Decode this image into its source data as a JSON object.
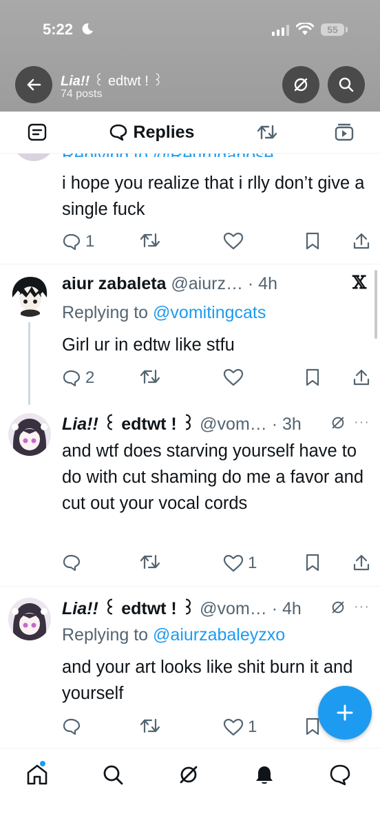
{
  "status_bar": {
    "time": "5:22",
    "battery": "55"
  },
  "header": {
    "name_part1": "Lia!!",
    "name_part2": " ꒰ edtwt ! ꒱",
    "posts_count": "74 posts"
  },
  "tabs": {
    "replies_label": "Replies"
  },
  "tweets": [
    {
      "replying_partial": "Replying to @Reuruganose",
      "text": "i hope you realize that i rlly don’t give a single fuck",
      "reply_count": "1",
      "repost_count": "",
      "like_count": ""
    },
    {
      "name": "aiur zabaleta",
      "handle_time": " @aiurz… · 4h",
      "replying_prefix": "Replying to ",
      "replying_to": "@vomitingcats",
      "text": "Girl ur in edtw like stfu",
      "reply_count": "2",
      "repost_count": "",
      "like_count": ""
    },
    {
      "name_part1": "Lia!!",
      "name_part2": " ꒰ edtwt ! ꒱",
      "handle_time": " @vom… · 3h",
      "text": "and wtf does starving yourself have to do with cut shaming do me a favor and cut out your vocal cords",
      "reply_count": "",
      "repost_count": "",
      "like_count": "1"
    },
    {
      "name_part1": "Lia!!",
      "name_part2": " ꒰ edtwt ! ꒱",
      "handle_time": " @vom… · 4h",
      "replying_prefix": "Replying to ",
      "replying_to": "@aiurzabaleyzxo",
      "text": "and your art looks like shit burn it and yourself",
      "reply_count": "",
      "repost_count": "",
      "like_count": "1"
    }
  ],
  "colors": {
    "accent": "#1d9bf0",
    "muted": "#536471",
    "header_bg": "#a3a3a3"
  },
  "icons": [
    "back-arrow-icon",
    "grok-icon",
    "search-icon",
    "posts-icon",
    "speech-bubble-icon",
    "repost-icon",
    "media-icon",
    "reply-icon",
    "like-icon",
    "bookmark-icon",
    "share-icon",
    "x-logo-icon",
    "more-icon",
    "plus-icon",
    "home-icon",
    "notifications-icon",
    "messages-icon"
  ]
}
